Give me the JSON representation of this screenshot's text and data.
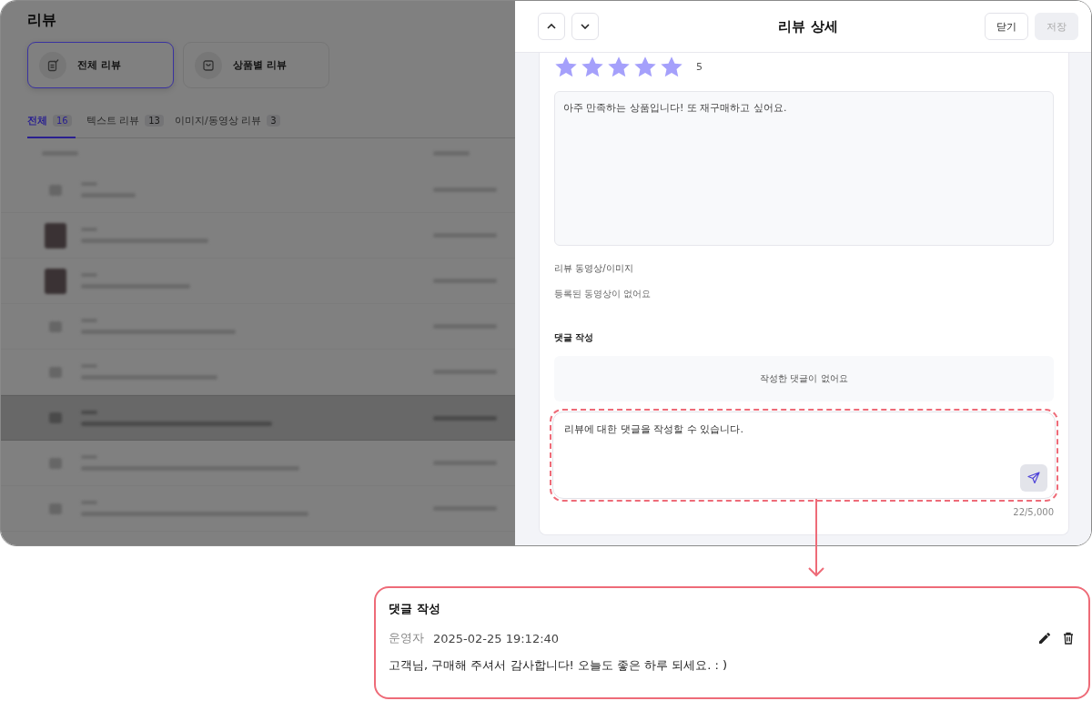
{
  "page": {
    "title": "리뷰"
  },
  "review_types": [
    {
      "label": "전체 리뷰",
      "selected": true
    },
    {
      "label": "상품별 리뷰",
      "selected": false
    }
  ],
  "tabs": [
    {
      "label": "전체",
      "count": "16",
      "selected": true
    },
    {
      "label": "텍스트 리뷰",
      "count": "13",
      "selected": false
    },
    {
      "label": "이미지/동영상 리뷰",
      "count": "3",
      "selected": false
    }
  ],
  "list_rows": [
    {
      "kind": "icon",
      "selected": false
    },
    {
      "kind": "photo",
      "selected": false
    },
    {
      "kind": "photo",
      "selected": false
    },
    {
      "kind": "icon",
      "selected": false
    },
    {
      "kind": "icon",
      "selected": false
    },
    {
      "kind": "icon",
      "selected": true
    },
    {
      "kind": "icon",
      "selected": false
    },
    {
      "kind": "icon",
      "selected": false
    }
  ],
  "detail_panel": {
    "title": "리뷰 상세",
    "buttons": [
      {
        "label": "닫기",
        "disabled": false
      },
      {
        "label": "저장",
        "disabled": true
      }
    ],
    "stars": 5,
    "rating": "5",
    "review_text": "아주 만족하는 상품입니다! 또 재구매하고 싶어요.",
    "media_label": "리뷰 동영상/이미지",
    "media_empty": "등록된 동영상이 없어요",
    "comment_heading": "댓글 작성",
    "comments_empty": "작성한 댓글이 없어요",
    "comment_input": "리뷰에 대한 댓글을 작성할 수 있습니다.",
    "char_count": "22/5,000"
  },
  "callout": {
    "heading": "댓글 작성",
    "author": "운영자",
    "timestamp": "2025-02-25 19:12:40",
    "text": "고객님, 구매해 주셔서 감사합니다! 오늘도 좋은 하루 되세요. : )"
  }
}
